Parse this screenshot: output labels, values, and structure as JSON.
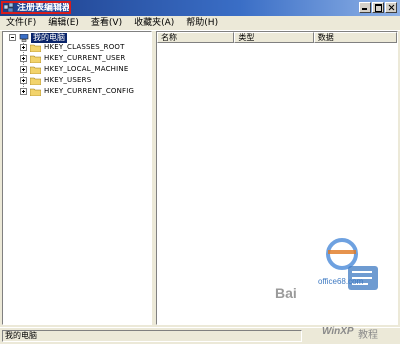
{
  "window": {
    "title": "注册表编辑器"
  },
  "menu": {
    "items": [
      "文件(F)",
      "编辑(E)",
      "查看(V)",
      "收藏夹(A)",
      "帮助(H)"
    ]
  },
  "tree": {
    "root_label": "我的电脑",
    "keys": [
      {
        "label": "HKEY_CLASSES_ROOT"
      },
      {
        "label": "HKEY_CURRENT_USER"
      },
      {
        "label": "HKEY_LOCAL_MACHINE"
      },
      {
        "label": "HKEY_USERS"
      },
      {
        "label": "HKEY_CURRENT_CONFIG"
      }
    ]
  },
  "list": {
    "columns": [
      "名称",
      "类型",
      "数据"
    ]
  },
  "statusbar": {
    "text": "我的电脑"
  },
  "watermark": {
    "baidu": "Bai",
    "site": "office68.com",
    "brand": "WinXP",
    "suffix": "教程"
  },
  "colors": {
    "title_gradient_start": "#1d3e8a",
    "title_gradient_end": "#8fb2e6",
    "selection": "#0a246a",
    "chrome": "#ece9d8",
    "highlight_box": "#d81c1c"
  },
  "icons": {
    "app": "regedit-icon",
    "root": "computer-icon",
    "key": "folder-icon"
  }
}
